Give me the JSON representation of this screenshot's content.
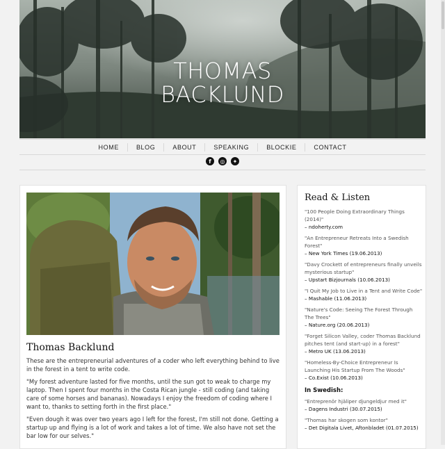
{
  "header": {
    "title_line1": "THOMAS",
    "title_line2": "BACKLUND"
  },
  "nav": {
    "items": [
      "HOME",
      "BLOG",
      "ABOUT",
      "SPEAKING",
      "BLOCKIE",
      "CONTACT"
    ]
  },
  "social": [
    {
      "icon": "facebook-icon",
      "glyph": "f"
    },
    {
      "icon": "instagram-icon",
      "glyph": "◎"
    },
    {
      "icon": "twitter-icon",
      "glyph": "✦"
    }
  ],
  "main": {
    "heading": "Thomas Backlund",
    "paragraphs": [
      "These are the entrepreneurial adventures of a coder who left everything behind to live in the forest in a tent to write code.",
      "\"My forest adventure lasted for five months, until the sun got to weak to charge my laptop. Then I spent four months in the Costa Rican jungle - still coding (and taking care of some horses and bananas). Nowadays I enjoy the freedom of coding where I want to, thanks to setting forth in the first place.\"",
      "\"Even dough it was over two years ago I left for the forest, I'm still not done. Getting a startup up and flying is a lot of work and takes a lot of time. We also have not set the bar low for our selves.\""
    ]
  },
  "sidebar": {
    "heading": "Read & Listen",
    "items": [
      {
        "title": "\"100 People Doing Extraordinary Things (2014)\"",
        "source": "– ndoherty.com"
      },
      {
        "title": "\"An Entrepreneur Retreats Into a Swedish Forest\"",
        "source": "– New York Times (19.06.2013)"
      },
      {
        "title": "\"Davy Crockett of entrepreneurs finally unveils mysterious startup\"",
        "source": "– Upstart Bizjournals (10.06.2013)"
      },
      {
        "title": "\"I Quit My Job to Live in a Tent and Write Code\"",
        "source": "– Mashable (11.06.2013)"
      },
      {
        "title": "\"Nature's Code: Seeing The Forest Through The Trees\"",
        "source": "– Nature.org (20.06.2013)"
      },
      {
        "title": "\"Forget Silicon Valley, coder Thomas Backlund pitches tent (and start-up) in a forest\"",
        "source": "– Metro UK (13.06.2013)"
      },
      {
        "title": "\"Homeless-By-Choice Entrepreneur Is Launching His Startup From The Woods\"",
        "source": "– Co.Exist (10.06.2013)"
      }
    ],
    "swedish_heading": "In Swedish:",
    "swedish_items": [
      {
        "title": "\"Entreprenör hjäliper djungeldjur med it\"",
        "source": "– Dagens Industri (30.07.2015)"
      },
      {
        "title": "\"Thomas har skogen som kontor\"",
        "source": "– Det Digitala Livet, Aftonbladet (01.07.2015)"
      }
    ]
  }
}
